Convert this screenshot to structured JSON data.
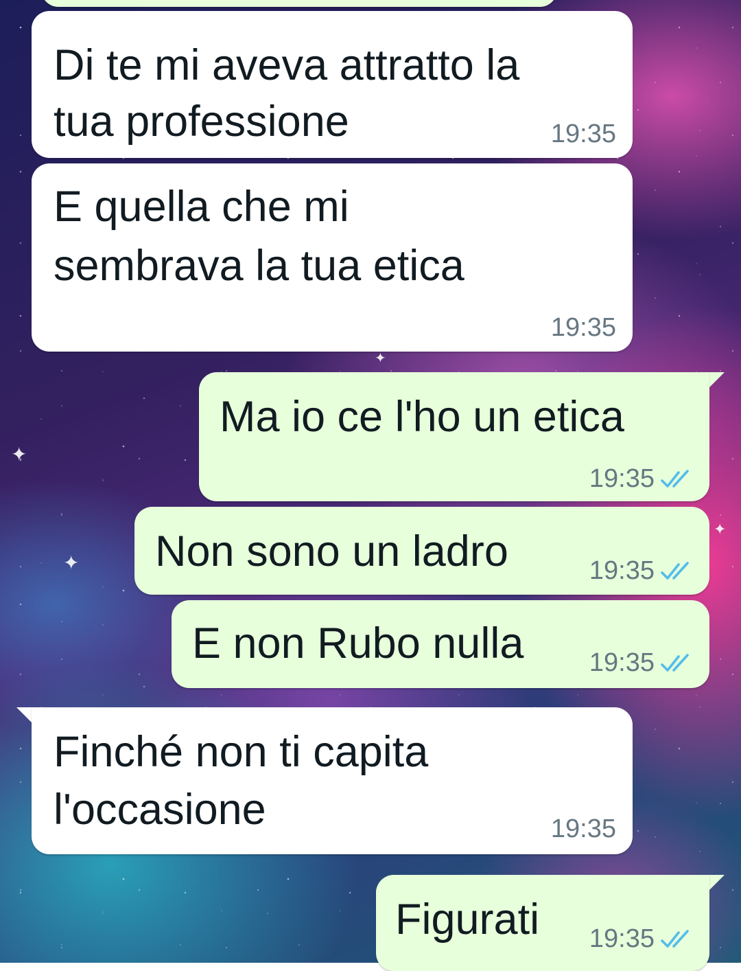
{
  "messages": [
    {
      "direction": "incoming",
      "text_lines": [
        "Di te mi aveva attratto la",
        "tua professione"
      ],
      "time": "19:35"
    },
    {
      "direction": "incoming",
      "text_lines": [
        "E quella che mi",
        "sembrava la tua etica"
      ],
      "time": "19:35"
    },
    {
      "direction": "outgoing",
      "text_lines": [
        "Ma io ce l'ho un etica"
      ],
      "time": "19:35",
      "status_icon": "double-check-read-icon"
    },
    {
      "direction": "outgoing",
      "text_lines": [
        "Non sono un ladro"
      ],
      "time": "19:35",
      "status_icon": "double-check-read-icon"
    },
    {
      "direction": "outgoing",
      "text_lines": [
        "E non Rubo nulla"
      ],
      "time": "19:35",
      "status_icon": "double-check-read-icon"
    },
    {
      "direction": "incoming",
      "text_lines": [
        "Finché non ti capita",
        "l'occasione"
      ],
      "time": "19:35"
    },
    {
      "direction": "outgoing",
      "text_lines": [
        "Figurati"
      ],
      "time": "19:35",
      "status_icon": "double-check-read-icon"
    }
  ],
  "colors": {
    "incoming_bubble": "#ffffff",
    "outgoing_bubble": "#e7ffdb",
    "message_text": "#111b21",
    "timestamp": "#667781",
    "read_ticks": "#53bdeb"
  }
}
